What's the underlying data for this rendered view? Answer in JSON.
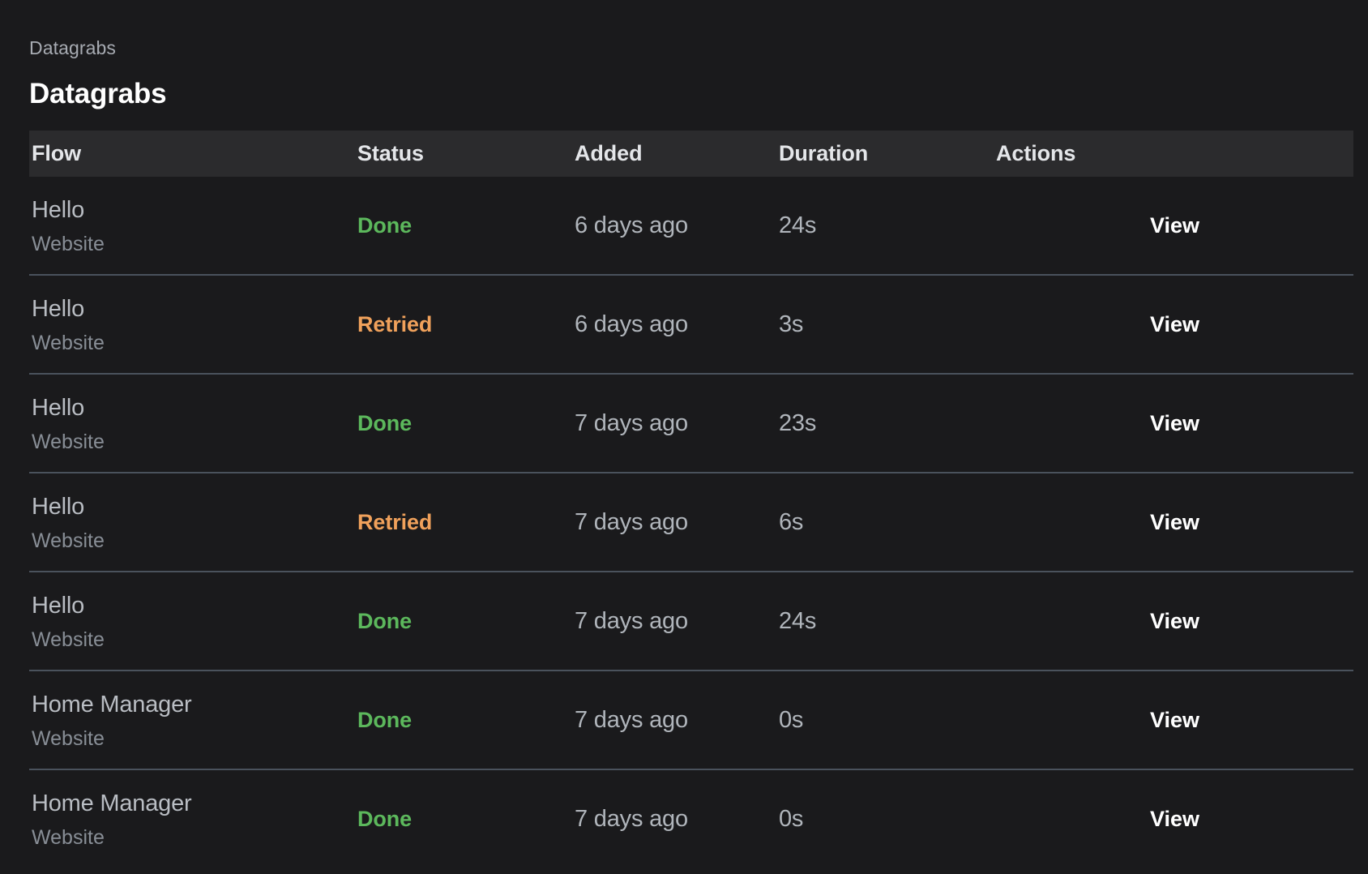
{
  "breadcrumb": "Datagrabs",
  "page_title": "Datagrabs",
  "colors": {
    "page_bg": "#1a1a1c",
    "header_bg": "#2b2b2d",
    "row_divider": "#4a525c",
    "status_done": "#5cb85c",
    "status_retried": "#f0a15b",
    "title": "#ffffff",
    "muted": "#888e96"
  },
  "table": {
    "columns": [
      {
        "key": "flow",
        "label": "Flow"
      },
      {
        "key": "status",
        "label": "Status"
      },
      {
        "key": "added",
        "label": "Added"
      },
      {
        "key": "duration",
        "label": "Duration"
      },
      {
        "key": "actions",
        "label": "Actions"
      }
    ],
    "rows": [
      {
        "flow": "Hello",
        "source": "Website",
        "status": "Done",
        "status_kind": "done",
        "added": "6 days ago",
        "duration": "24s",
        "action": "View"
      },
      {
        "flow": "Hello",
        "source": "Website",
        "status": "Retried",
        "status_kind": "retried",
        "added": "6 days ago",
        "duration": "3s",
        "action": "View"
      },
      {
        "flow": "Hello",
        "source": "Website",
        "status": "Done",
        "status_kind": "done",
        "added": "7 days ago",
        "duration": "23s",
        "action": "View"
      },
      {
        "flow": "Hello",
        "source": "Website",
        "status": "Retried",
        "status_kind": "retried",
        "added": "7 days ago",
        "duration": "6s",
        "action": "View"
      },
      {
        "flow": "Hello",
        "source": "Website",
        "status": "Done",
        "status_kind": "done",
        "added": "7 days ago",
        "duration": "24s",
        "action": "View"
      },
      {
        "flow": "Home Manager",
        "source": "Website",
        "status": "Done",
        "status_kind": "done",
        "added": "7 days ago",
        "duration": "0s",
        "action": "View"
      },
      {
        "flow": "Home Manager",
        "source": "Website",
        "status": "Done",
        "status_kind": "done",
        "added": "7 days ago",
        "duration": "0s",
        "action": "View"
      }
    ]
  }
}
